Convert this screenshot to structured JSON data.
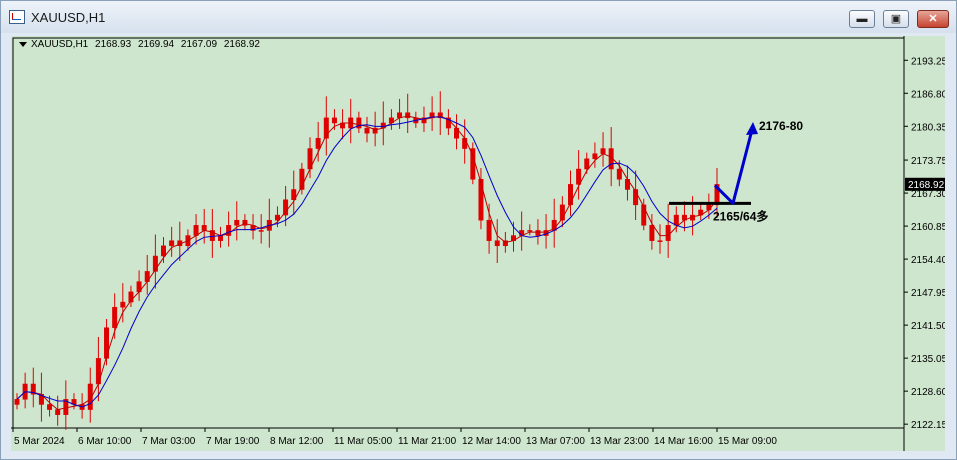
{
  "window": {
    "title": "XAUUSD,H1",
    "buttons": {
      "minimize": "▬",
      "maximize": "▣",
      "close": "✕"
    }
  },
  "chart_info": {
    "symbol_tf": "XAUUSD,H1",
    "open": "2168.93",
    "high": "2169.94",
    "low": "2167.09",
    "close": "2168.92"
  },
  "colors": {
    "background": "#cee6cd",
    "candle": "#e00000",
    "ma_fast": "#c00000",
    "ma_slow": "#0000cc",
    "forecast": "#0000cc",
    "support_line": "#000000",
    "price_badge": "#000000"
  },
  "icons": [
    "window-icon",
    "minimize-icon",
    "maximize-icon",
    "close-icon",
    "dropdown-triangle-icon",
    "arrow-icon"
  ],
  "chart_data": {
    "type": "candlestick",
    "y_axis": {
      "ticks": [
        "2193.25",
        "2186.80",
        "2180.35",
        "2173.75",
        "2167.30",
        "2160.85",
        "2154.40",
        "2147.95",
        "2141.50",
        "2135.05",
        "2128.60",
        "2122.15"
      ],
      "range": [
        2121.4,
        2197.6
      ]
    },
    "x_axis": {
      "ticks": [
        "5 Mar 2024",
        "6 Mar 10:00",
        "7 Mar 03:00",
        "7 Mar 19:00",
        "8 Mar 12:00",
        "11 Mar 05:00",
        "11 Mar 21:00",
        "12 Mar 14:00",
        "13 Mar 07:00",
        "13 Mar 23:00",
        "14 Mar 16:00",
        "15 Mar 09:00"
      ]
    },
    "current_price": "2168.92",
    "close_series": [
      2127,
      2130,
      2128,
      2126,
      2125,
      2124,
      2127,
      2126,
      2125,
      2130,
      2135,
      2141,
      2145,
      2146,
      2148,
      2150,
      2152,
      2155,
      2157,
      2158,
      2157,
      2159,
      2161,
      2160,
      2158,
      2159,
      2161,
      2162,
      2161,
      2160,
      2160,
      2162,
      2163,
      2166,
      2168,
      2172,
      2176,
      2178,
      2182,
      2181,
      2180,
      2182,
      2180,
      2179,
      2180,
      2181,
      2182,
      2183,
      2182,
      2181,
      2182,
      2183,
      2182,
      2180,
      2178,
      2176,
      2170,
      2162,
      2158,
      2157,
      2158,
      2159,
      2160,
      2160,
      2159,
      2160,
      2162,
      2165,
      2169,
      2172,
      2174,
      2175,
      2176,
      2172,
      2170,
      2168,
      2165,
      2161,
      2158,
      2158,
      2161,
      2163,
      2162,
      2163,
      2164,
      2165,
      2169
    ],
    "forecast_path": [
      2168.8,
      2165.3,
      2180.4
    ],
    "support_level": 2165.3,
    "annotations": {
      "target": "2176-80",
      "support": "2165/64多"
    }
  }
}
